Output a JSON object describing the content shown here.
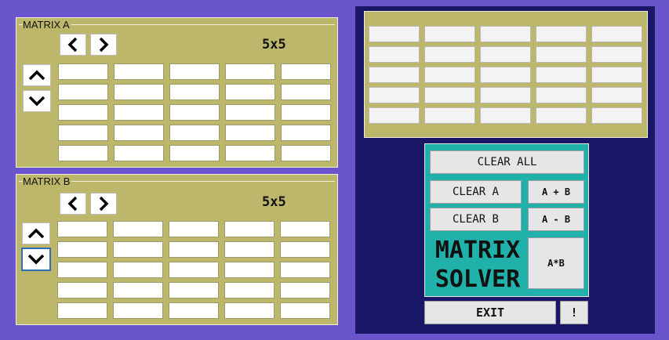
{
  "matrix_a": {
    "title": "MATRIX A",
    "size_label": "5x5",
    "rows": 5,
    "cols": 5
  },
  "matrix_b": {
    "title": "MATRIX B",
    "size_label": "5x5",
    "rows": 5,
    "cols": 5
  },
  "result": {
    "rows": 5,
    "cols": 5
  },
  "controls": {
    "clear_all": "CLEAR ALL",
    "clear_a": "CLEAR A",
    "clear_b": "CLEAR B",
    "add": "A + B",
    "subtract": "A - B",
    "multiply": "A*B",
    "title_line1": "MATRIX",
    "title_line2": "SOLVER",
    "exit": "EXIT",
    "info": "!"
  },
  "colors": {
    "background": "#6b55cd",
    "panel": "#bdb76b",
    "result_background": "#1a1866",
    "control_panel": "#20b2aa",
    "focus": "#2f6fb6"
  },
  "icons": {
    "prev": "chevron-left-icon",
    "next": "chevron-right-icon",
    "up": "chevron-up-icon",
    "down": "chevron-down-icon"
  }
}
